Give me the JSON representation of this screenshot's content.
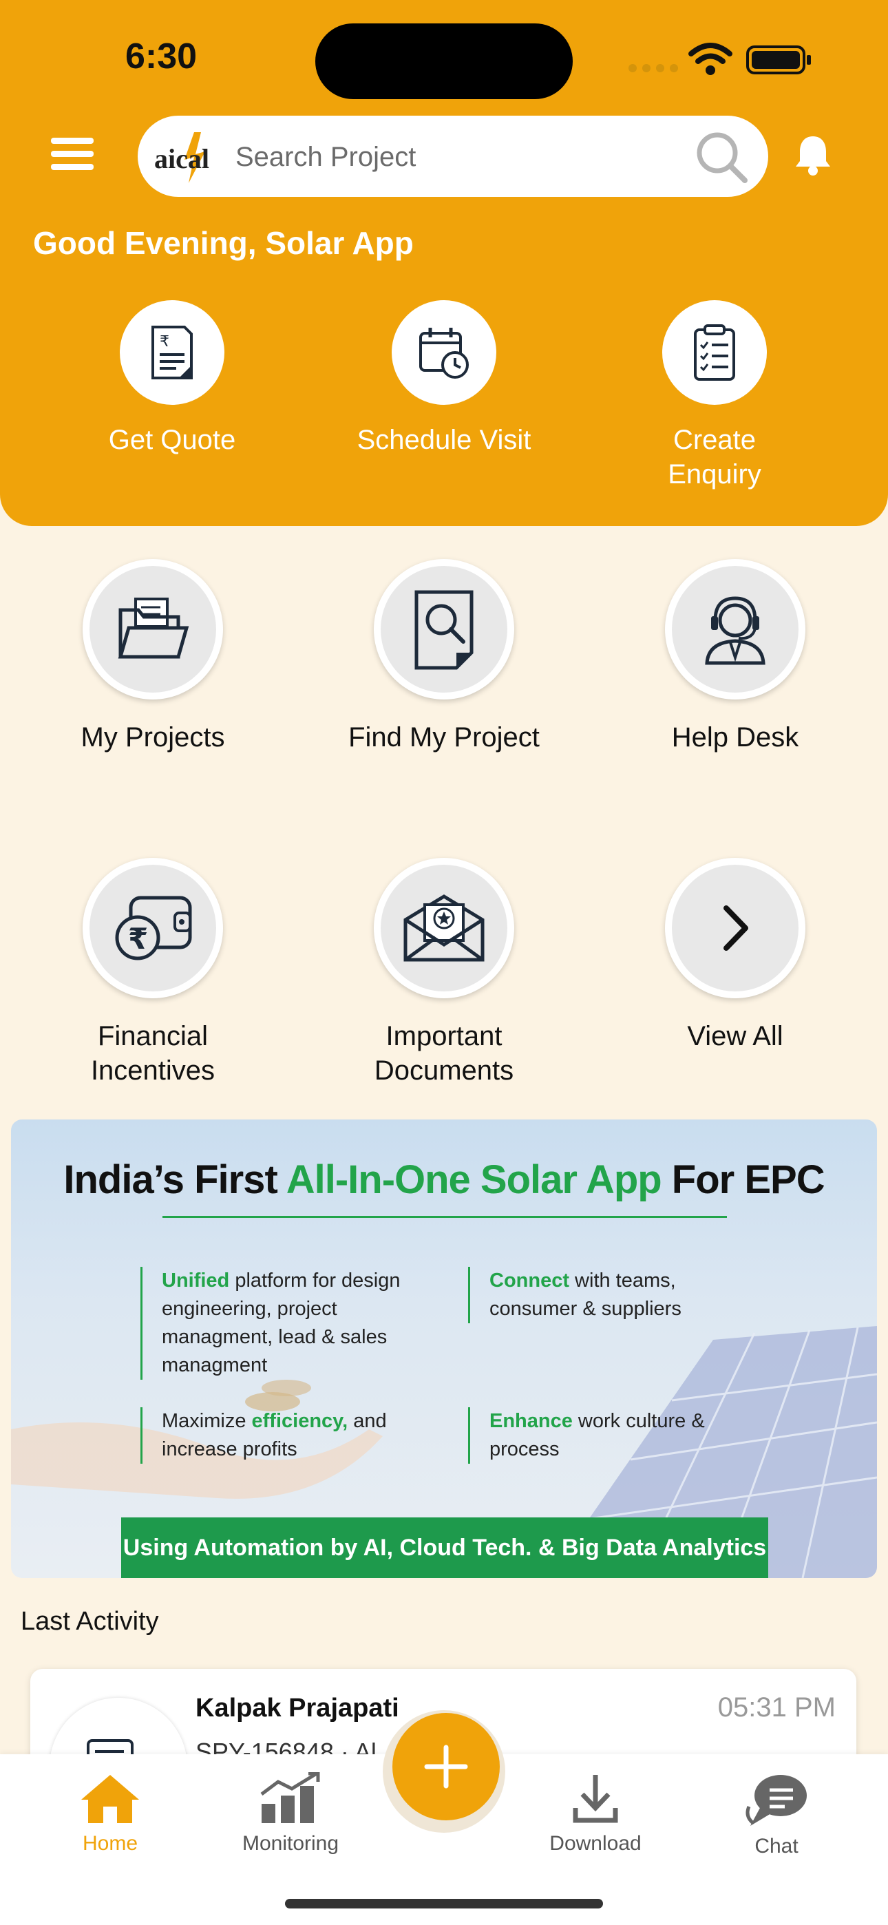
{
  "status_bar": {
    "time": "6:30"
  },
  "header": {
    "logo_text": "aical",
    "search_placeholder": "Search Project",
    "greeting": "Good Evening, Solar App"
  },
  "quick_actions": [
    {
      "label": "Get Quote",
      "icon": "quote-document-icon"
    },
    {
      "label": "Schedule Visit",
      "icon": "calendar-clock-icon"
    },
    {
      "label": "Create Enquiry",
      "icon": "clipboard-checklist-icon"
    }
  ],
  "grid": [
    {
      "label": "My Projects",
      "icon": "folder-icon"
    },
    {
      "label": "Find My Project",
      "icon": "document-search-icon"
    },
    {
      "label": "Help Desk",
      "icon": "support-agent-icon"
    },
    {
      "label": "Financial Incentives",
      "icon": "wallet-rupee-icon"
    },
    {
      "label": "Important Documents",
      "icon": "envelope-star-icon"
    },
    {
      "label": "View All",
      "icon": "chevron-right-icon"
    }
  ],
  "banner": {
    "title_part1": "India’s First ",
    "title_green": "All-In-One Solar App",
    "title_part3": " For EPC",
    "b1_green": "Unified",
    "b1_text": " platform for design engineering, project managment, lead & sales managment",
    "b2_green": "Connect",
    "b2_text": " with teams, consumer & suppliers",
    "b3_pre": "Maximize ",
    "b3_green": "efficiency,",
    "b3_text": " and increase profits",
    "b4_green": "Enhance",
    "b4_text": " work culture & process",
    "strip": "Using Automation by AI, Cloud Tech. & Big Data Analytics"
  },
  "last_activity": {
    "title": "Last Activity",
    "name": "Kalpak Prajapati",
    "time": "05:31 PM",
    "subtitle": "SPY-156848 · Al..."
  },
  "bottom_nav": [
    {
      "label": "Home",
      "icon": "home-icon",
      "active": true
    },
    {
      "label": "Monitoring",
      "icon": "bar-chart-icon"
    },
    {
      "label": "Download",
      "icon": "download-icon"
    },
    {
      "label": "Chat",
      "icon": "chat-icon"
    }
  ],
  "colors": {
    "accent": "#F0A30A",
    "background": "#FCF3E3",
    "green": "#22A44A"
  }
}
